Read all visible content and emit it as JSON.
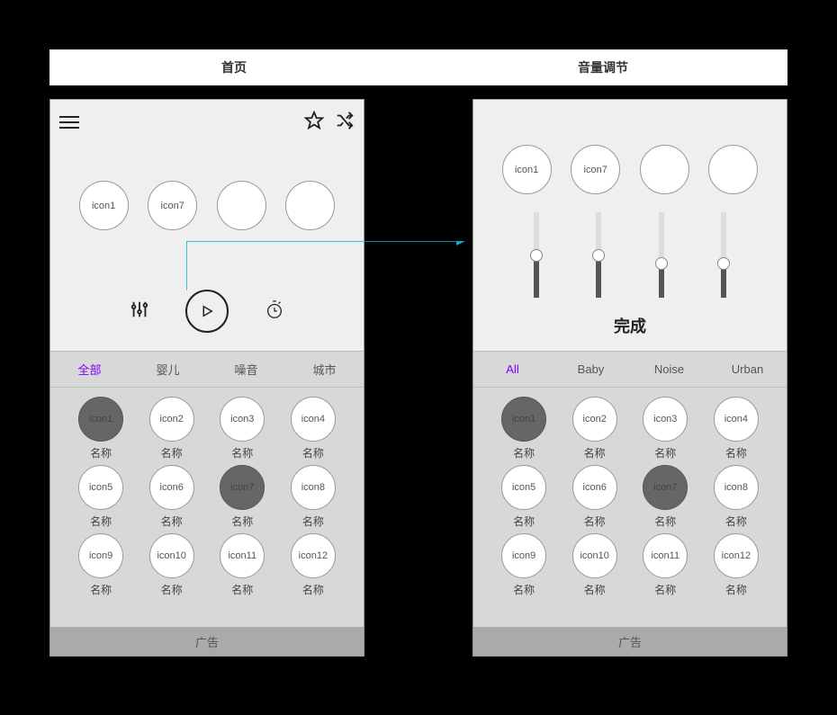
{
  "labels": {
    "left": "首页",
    "right": "音量调节"
  },
  "left": {
    "top_circles": [
      {
        "label": "icon1"
      },
      {
        "label": "icon7"
      },
      {
        "label": ""
      },
      {
        "label": ""
      }
    ],
    "tabs": [
      {
        "label": "全部",
        "active": true
      },
      {
        "label": "婴儿",
        "active": false
      },
      {
        "label": "噪音",
        "active": false
      },
      {
        "label": "城市",
        "active": false
      }
    ],
    "grid": [
      {
        "icon": "icon1",
        "label": "名称",
        "selected": true
      },
      {
        "icon": "icon2",
        "label": "名称",
        "selected": false
      },
      {
        "icon": "icon3",
        "label": "名称",
        "selected": false
      },
      {
        "icon": "icon4",
        "label": "名称",
        "selected": false
      },
      {
        "icon": "icon5",
        "label": "名称",
        "selected": false
      },
      {
        "icon": "icon6",
        "label": "名称",
        "selected": false
      },
      {
        "icon": "icon7",
        "label": "名称",
        "selected": true
      },
      {
        "icon": "icon8",
        "label": "名称",
        "selected": false
      },
      {
        "icon": "icon9",
        "label": "名称",
        "selected": false
      },
      {
        "icon": "icon10",
        "label": "名称",
        "selected": false
      },
      {
        "icon": "icon11",
        "label": "名称",
        "selected": false
      },
      {
        "icon": "icon12",
        "label": "名称",
        "selected": false
      }
    ],
    "ad": "广告"
  },
  "right": {
    "top_circles": [
      {
        "label": "icon1"
      },
      {
        "label": "icon7"
      },
      {
        "label": ""
      },
      {
        "label": ""
      }
    ],
    "sliders": [
      {
        "value": 50
      },
      {
        "value": 50
      },
      {
        "value": 40
      },
      {
        "value": 40
      }
    ],
    "done": "完成",
    "tabs": [
      {
        "label": "All",
        "active": true
      },
      {
        "label": "Baby",
        "active": false
      },
      {
        "label": "Noise",
        "active": false
      },
      {
        "label": "Urban",
        "active": false
      }
    ],
    "grid": [
      {
        "icon": "icon1",
        "label": "名称",
        "selected": true
      },
      {
        "icon": "icon2",
        "label": "名称",
        "selected": false
      },
      {
        "icon": "icon3",
        "label": "名称",
        "selected": false
      },
      {
        "icon": "icon4",
        "label": "名称",
        "selected": false
      },
      {
        "icon": "icon5",
        "label": "名称",
        "selected": false
      },
      {
        "icon": "icon6",
        "label": "名称",
        "selected": false
      },
      {
        "icon": "icon7",
        "label": "名称",
        "selected": true
      },
      {
        "icon": "icon8",
        "label": "名称",
        "selected": false
      },
      {
        "icon": "icon9",
        "label": "名称",
        "selected": false
      },
      {
        "icon": "icon10",
        "label": "名称",
        "selected": false
      },
      {
        "icon": "icon11",
        "label": "名称",
        "selected": false
      },
      {
        "icon": "icon12",
        "label": "名称",
        "selected": false
      }
    ],
    "ad": "广告"
  },
  "arrow_color": "#00b0d7"
}
